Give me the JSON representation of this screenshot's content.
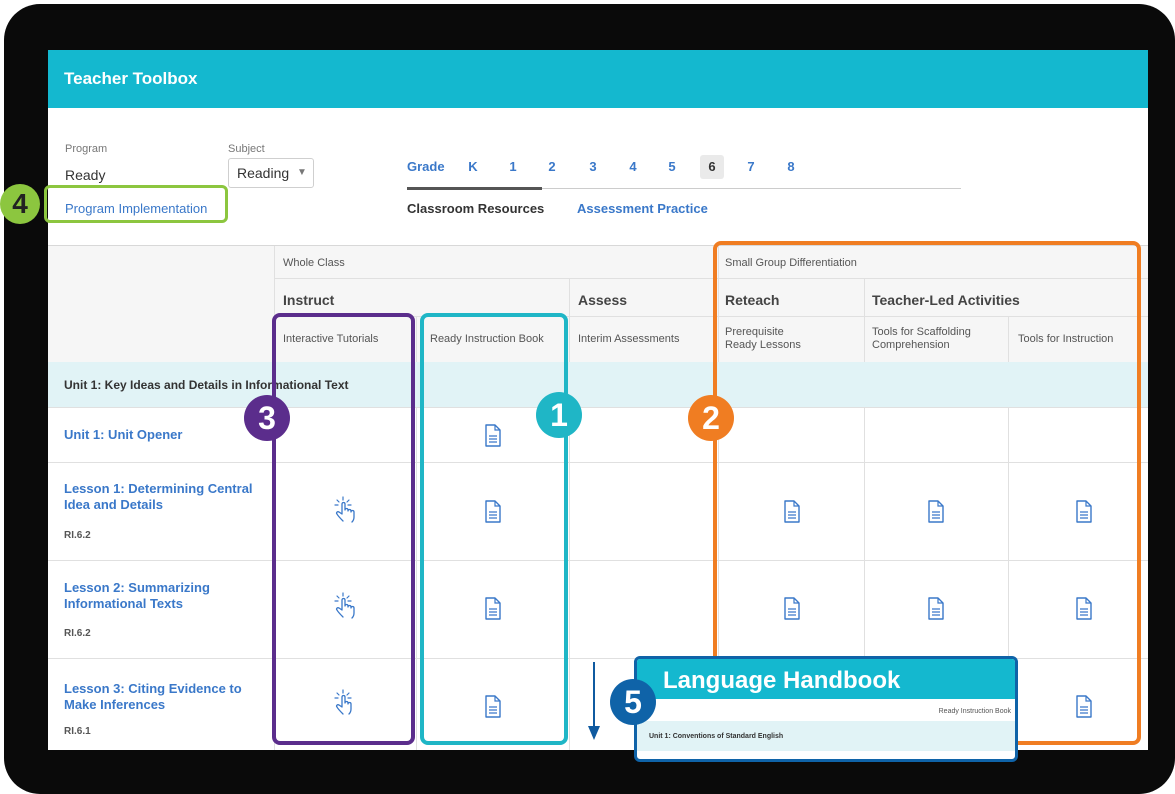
{
  "app": {
    "title": "Teacher Toolbox"
  },
  "filters": {
    "program_label": "Program",
    "program_value": "Ready",
    "subject_label": "Subject",
    "subject_value": "Reading",
    "implementation_link": "Program Implementation"
  },
  "grades": {
    "label": "Grade",
    "items": [
      "K",
      "1",
      "2",
      "3",
      "4",
      "5",
      "6",
      "7",
      "8"
    ],
    "selected": "6"
  },
  "tabs": [
    "Classroom Resources",
    "Assessment Practice"
  ],
  "table": {
    "group_whole_class": "Whole Class",
    "group_small_group": "Small Group Differentiation",
    "sections": {
      "instruct": "Instruct",
      "assess": "Assess",
      "reteach": "Reteach",
      "teacher_led": "Teacher-Led Activities"
    },
    "columns": [
      "Interactive Tutorials",
      "Ready Instruction Book",
      "Interim Assessments",
      "Prerequisite\nReady Lessons",
      "Tools for Scaffolding\nComprehension",
      "Tools for Instruction"
    ],
    "unit_title": "Unit 1: Key Ideas and Details in Informational Text",
    "rows": [
      {
        "title": "Unit 1: Unit Opener",
        "standard": ""
      },
      {
        "title": "Lesson 1: Determining Central Idea and Details",
        "standard": "RI.6.2"
      },
      {
        "title": "Lesson 2: Summarizing Informational Texts",
        "standard": "RI.6.2"
      },
      {
        "title": "Lesson 3: Citing Evidence to Make Inferences",
        "standard": "RI.6.1"
      }
    ]
  },
  "callouts": {
    "one": "1",
    "two": "2",
    "three": "3",
    "four": "4",
    "five": "5"
  },
  "language_handbook": {
    "title": "Language Handbook",
    "column": "Ready Instruction Book",
    "unit": "Unit 1: Conventions of Standard English"
  },
  "colors": {
    "header": "#14b8cf",
    "teal": "#1fb6c6",
    "orange": "#f07d22",
    "purple": "#5b2d8c",
    "green": "#8cc63f",
    "navy": "#0f63a8"
  }
}
